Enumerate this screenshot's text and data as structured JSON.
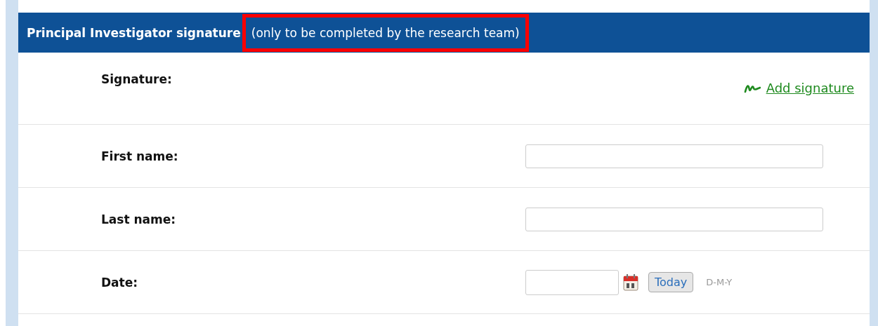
{
  "section": {
    "title": "Principal Investigator signature",
    "note": "(only to be completed by the research team)",
    "note_highlighted": true
  },
  "rows": [
    {
      "kind": "signature",
      "label": "Signature:",
      "link": "Add signature"
    },
    {
      "kind": "text",
      "label": "First name:"
    },
    {
      "kind": "text",
      "label": "Last name:"
    },
    {
      "kind": "date",
      "label": "Date:",
      "button": "Today",
      "format": "D-M-Y"
    }
  ]
}
